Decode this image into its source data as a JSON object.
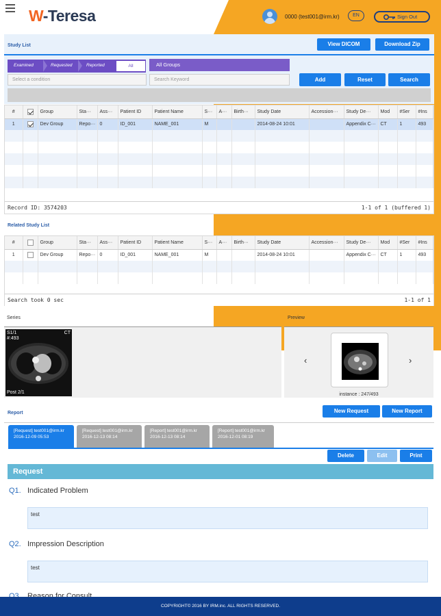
{
  "header": {
    "logo_w": "W",
    "logo_text": "-Teresa",
    "user": "0000 (test001@irm.kr)",
    "lang": "EN",
    "signout": "Sign Out"
  },
  "study": {
    "title": "Study List",
    "view_dicom": "View DICOM",
    "download_zip": "Download Zip",
    "filters": [
      "Examined",
      "Requested",
      "Reported",
      "All"
    ],
    "groups": "All Groups",
    "condition_placeholder": "Select a condition",
    "keyword_placeholder": "Search Keyword",
    "add": "Add",
    "reset": "Reset",
    "search": "Search",
    "columns": [
      "#",
      "",
      "Group",
      "Sta···",
      "Ass···",
      "Patient ID",
      "Patient Name",
      "S···",
      "A···",
      "Birth···",
      "Study Date",
      "Accession···",
      "Study De···",
      "Mod",
      "#Ser",
      "#Ins"
    ],
    "rows": [
      [
        "1",
        "",
        "Dev Group",
        "Repo···",
        "0",
        "ID_001",
        "NAME_001",
        "M",
        "",
        "",
        "2014-08-24 10:01",
        "",
        "Appendix C···",
        "CT",
        "1",
        "493"
      ]
    ],
    "record": "Record ID: 3574203",
    "count": "1-1 of 1 (buffered 1)"
  },
  "related": {
    "title": "Related Study List",
    "columns": [
      "#",
      "",
      "Group",
      "Sta···",
      "Ass···",
      "Patient ID",
      "Patient Name",
      "S···",
      "A···",
      "Birth···",
      "Study Date",
      "Accession···",
      "Study De···",
      "Mod",
      "#Ser",
      "#Ins"
    ],
    "rows": [
      [
        "1",
        "",
        "Dev Group",
        "Repo···",
        "0",
        "ID_001",
        "NAME_001",
        "M",
        "",
        "",
        "2014-08-24 10:01",
        "",
        "Appendix C···",
        "CT",
        "1",
        "493"
      ]
    ],
    "status": "Search took 0 sec",
    "count": "1-1 of 1"
  },
  "series": {
    "title": "Series",
    "overlay_tl1": "S1/1",
    "overlay_tl2": "#:493",
    "overlay_tr": "CT",
    "overlay_bl": "Post 2/1"
  },
  "preview": {
    "title": "Preview",
    "caption": "instance : 247/493"
  },
  "report": {
    "title": "Report",
    "new_request": "New Request",
    "new_report": "New Report",
    "tabs": [
      {
        "l1": "[Request] test001@irm.kr",
        "l2": "2016-12-09 05:53"
      },
      {
        "l1": "[Request] test001@irm.kr",
        "l2": "2016-12-13 08:14"
      },
      {
        "l1": "[Report] test001@irm.kr",
        "l2": "2016-12-13 08:14"
      },
      {
        "l1": "[Report] test001@irm.kr",
        "l2": "2016-12-01 08:19"
      }
    ],
    "delete": "Delete",
    "edit": "Edit",
    "print": "Print",
    "section": "Request",
    "q1n": "Q1.",
    "q1": "Indicated Problem",
    "a1": "test",
    "q2n": "Q2.",
    "q2": "Impression Description",
    "a2": "test",
    "q3n": "Q3.",
    "q3": "Reason for Consult"
  },
  "footer": "COPYRIGHT© 2016 BY IRM.inc. ALL RIGHTS RESERVED."
}
